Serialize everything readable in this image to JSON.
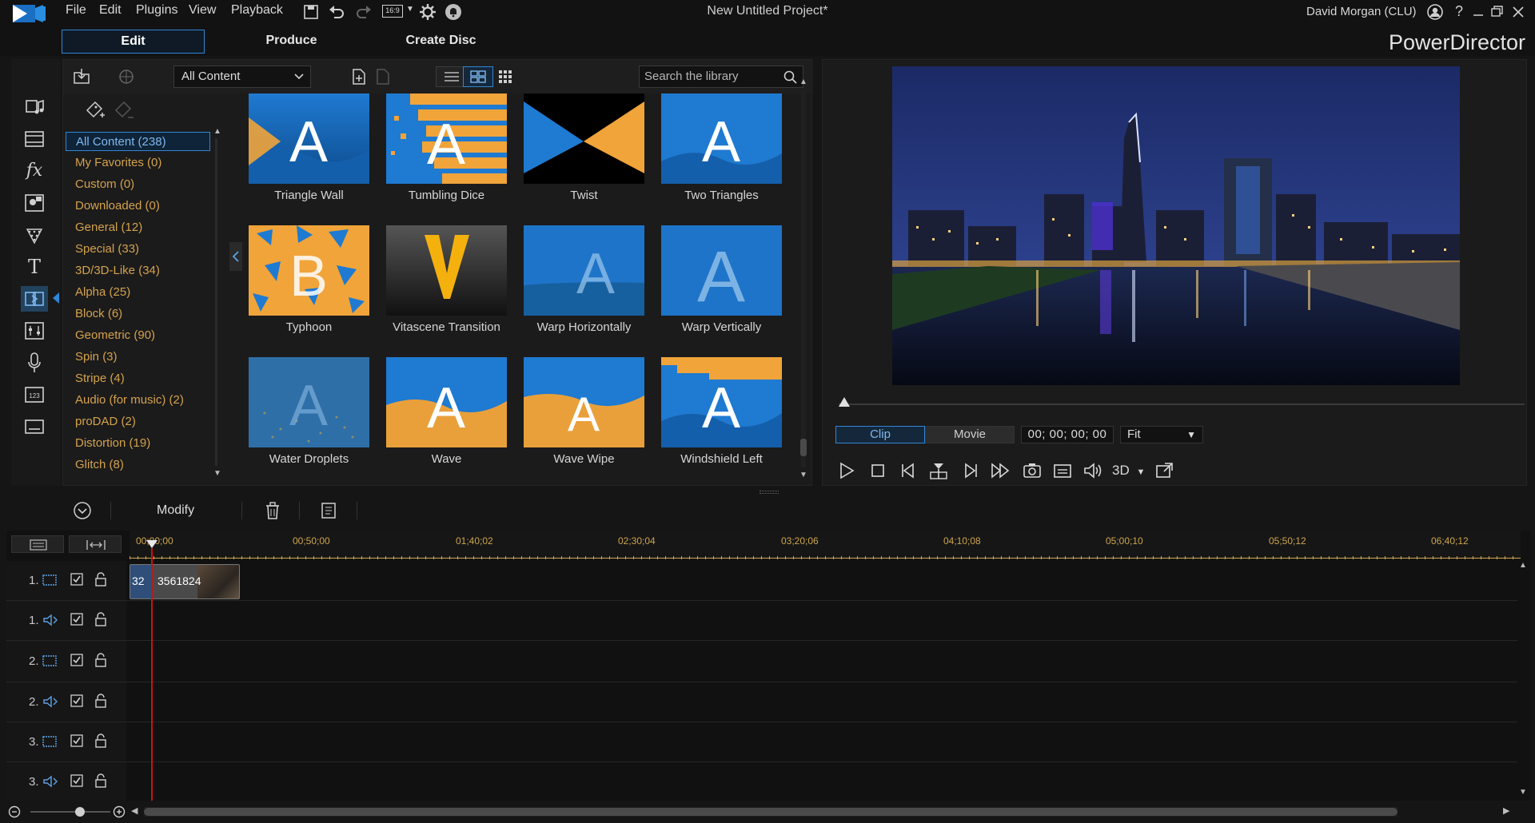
{
  "menu": [
    "File",
    "Edit",
    "Plugins",
    "View",
    "Playback"
  ],
  "toolbar": {
    "aspect_ratio": "16:9"
  },
  "project_title": "New Untitled Project*",
  "user": "David Morgan (CLU)",
  "window_buttons": [
    "account-icon",
    "help-icon",
    "minimize-icon",
    "restore-icon",
    "close-icon"
  ],
  "modes": [
    {
      "label": "Edit",
      "active": true
    },
    {
      "label": "Produce",
      "active": false
    },
    {
      "label": "Create Disc",
      "active": false
    }
  ],
  "brand": "PowerDirector",
  "library": {
    "filter": "All Content",
    "search_placeholder": "Search the library",
    "categories": [
      "All Content (238)",
      "My Favorites  (0)",
      "Custom  (0)",
      "Downloaded  (0)",
      "General  (12)",
      "Special  (33)",
      "3D/3D-Like  (34)",
      "Alpha  (25)",
      "Block  (6)",
      "Geometric  (90)",
      "Spin  (3)",
      "Stripe  (4)",
      "Audio (for music)  (2)",
      "proDAD  (2)",
      "Distortion  (19)",
      "Glitch  (8)"
    ],
    "transitions": [
      "Triangle Wall",
      "Tumbling Dice",
      "Twist",
      "Two Triangles",
      "Typhoon",
      "Vitascene Transition",
      "Warp Horizontally",
      "Warp Vertically",
      "Water Droplets",
      "Wave",
      "Wave Wipe",
      "Windshield Left"
    ]
  },
  "preview": {
    "clip_label": "Clip",
    "movie_label": "Movie",
    "timecode": "00; 00; 00; 00",
    "fit": "Fit",
    "threed_label": "3D"
  },
  "edit_toolbar": {
    "modify": "Modify"
  },
  "timeline": {
    "ticks": [
      "00;00;00",
      "00;50;00",
      "01;40;02",
      "02;30;04",
      "03;20;06",
      "04;10;08",
      "05;00;10",
      "05;50;12",
      "06;40;12"
    ],
    "tracks": [
      "1.",
      "1.",
      "2.",
      "2.",
      "3.",
      "3."
    ],
    "clip_label": "3561824",
    "clip_badge": "32"
  },
  "colors": {
    "accent": "#2f86d6",
    "category": "#d4a24d",
    "tick": "#cfa64e",
    "playhead": "#d01010"
  }
}
